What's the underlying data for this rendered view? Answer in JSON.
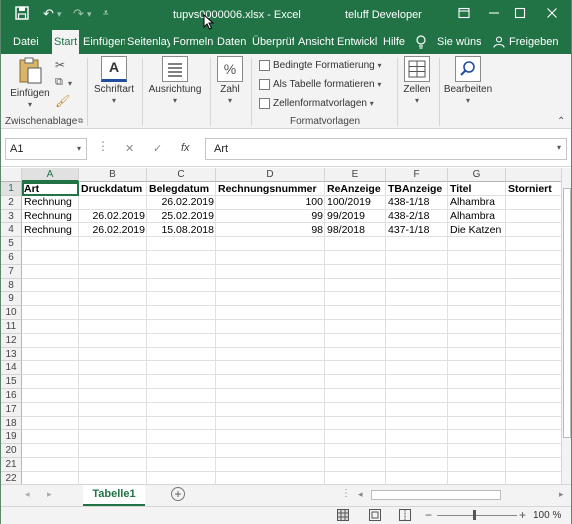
{
  "app": {
    "file_title": "tupvs0000006.xlsx - Excel",
    "user": "teluff Developer"
  },
  "title_icons": {
    "save": "save-icon",
    "undo": "undo-icon",
    "redo": "redo-icon",
    "customize": "customize-qat-icon",
    "restore": "ribbon-display-icon",
    "minimize": "minimize-icon",
    "maximize": "maximize-icon",
    "close": "close-icon"
  },
  "tabs": [
    "Datei",
    "Start",
    "Einfügen",
    "Seitenlay",
    "Formeln",
    "Daten",
    "Überprüf",
    "Ansicht",
    "Entwickl",
    "Hilfe"
  ],
  "tell_me": "Sie wünsc",
  "share": "Freigeben",
  "ribbon": {
    "clipboard": {
      "paste": "Einfügen",
      "label": "Zwischenablage"
    },
    "font": {
      "label": "Schriftart"
    },
    "alignment": {
      "label": "Ausrichtung"
    },
    "number": {
      "label": "Zahl"
    },
    "styles": {
      "cond": "Bedingte Formatierung",
      "table": "Als Tabelle formatieren",
      "cellstyles": "Zellenformatvorlagen",
      "label": "Formatvorlagen"
    },
    "cells": {
      "label": "Zellen"
    },
    "editing": {
      "label": "Bearbeiten"
    }
  },
  "formula_bar": {
    "name_box": "A1",
    "fx": "fx",
    "value": "Art"
  },
  "columns": [
    "A",
    "B",
    "C",
    "D",
    "E",
    "F",
    "G"
  ],
  "rows": [
    "1",
    "2",
    "3",
    "4",
    "5",
    "6",
    "7",
    "8",
    "9",
    "10",
    "11",
    "12",
    "13",
    "14",
    "15",
    "16",
    "17",
    "18",
    "19",
    "20",
    "21",
    "22"
  ],
  "headers": [
    "Art",
    "Druckdatum",
    "Belegdatum",
    "Rechnungsnummer",
    "ReAnzeige",
    "TBAnzeige",
    "Titel",
    "Storniert"
  ],
  "data": [
    [
      "Rechnung",
      "",
      "26.02.2019",
      "100",
      "100/2019",
      "438-1/18",
      "Alhambra"
    ],
    [
      "Rechnung",
      "26.02.2019",
      "25.02.2019",
      "99",
      "99/2019",
      "438-2/18",
      "Alhambra"
    ],
    [
      "Rechnung",
      "26.02.2019",
      "15.08.2018",
      "98",
      "98/2018",
      "437-1/18",
      "Die Katzen"
    ]
  ],
  "sheet": {
    "tab": "Tabelle1"
  },
  "status": {
    "zoom": "100 %"
  }
}
